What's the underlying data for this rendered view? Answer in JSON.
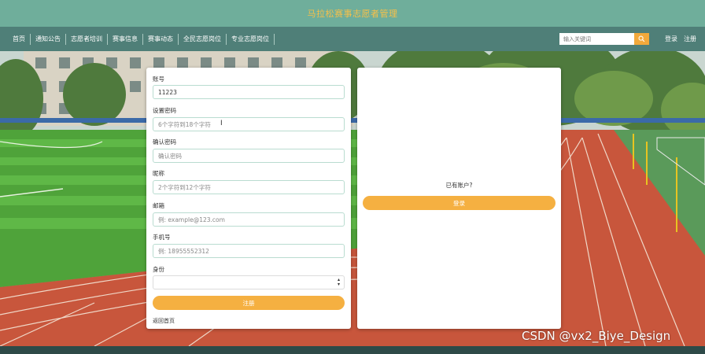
{
  "header": {
    "site_title": "马拉松赛事志愿者管理"
  },
  "nav": {
    "items": [
      {
        "label": "首页"
      },
      {
        "label": "通知公告"
      },
      {
        "label": "志愿者培训"
      },
      {
        "label": "赛事信息"
      },
      {
        "label": "赛事动态"
      },
      {
        "label": "全民志愿岗位"
      },
      {
        "label": "专业志愿岗位"
      }
    ],
    "search": {
      "placeholder": "输入关键词",
      "icon": "search-icon"
    },
    "auth": {
      "login_label": "登录",
      "register_label": "注册"
    }
  },
  "register_form": {
    "account": {
      "label": "账号",
      "value": "11223"
    },
    "password": {
      "label": "设置密码",
      "placeholder": "6个字符到18个字符"
    },
    "confirm_password": {
      "label": "确认密码",
      "placeholder": "确认密码"
    },
    "nickname": {
      "label": "昵称",
      "placeholder": "2个字符到12个字符"
    },
    "email": {
      "label": "邮箱",
      "placeholder": "例: example@123.com"
    },
    "phone": {
      "label": "手机号",
      "placeholder": "例: 18955552312"
    },
    "identity": {
      "label": "身份",
      "value": ""
    },
    "submit_label": "注册",
    "back_home_label": "返回首页"
  },
  "login_panel": {
    "prompt": "已有账户?",
    "login_label": "登录"
  },
  "watermark": "CSDN @vx2_Biye_Design",
  "colors": {
    "header_bg": "#6fae9b",
    "nav_bg": "#4f7f78",
    "title_color": "#f6c04a",
    "accent": "#f5b041"
  }
}
